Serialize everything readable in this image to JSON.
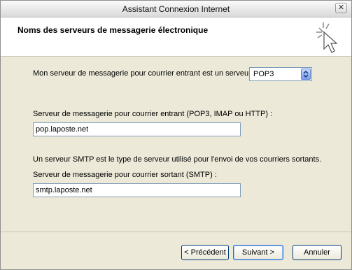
{
  "window": {
    "title": "Assistant Connexion Internet"
  },
  "icons": {
    "close": "close-icon",
    "wizard": "wizard-cursor-icon",
    "dropdown": "chevron-down-icon"
  },
  "header": {
    "title": "Noms des serveurs de messagerie électronique"
  },
  "incoming_server_type": {
    "label": "Mon serveur de messagerie pour courrier entrant est un serveur",
    "selected": "POP3"
  },
  "incoming_server": {
    "label": "Serveur de messagerie pour courrier entrant (POP3, IMAP ou HTTP) :",
    "value": "pop.laposte.net"
  },
  "smtp_info": "Un serveur SMTP est le type de serveur utilisé pour l'envoi de vos courriers sortants.",
  "outgoing_server": {
    "label": "Serveur de messagerie pour courrier sortant (SMTP) :",
    "value": "smtp.laposte.net"
  },
  "buttons": {
    "back": "< Précédent",
    "next": "Suivant >",
    "cancel": "Annuler"
  },
  "colors": {
    "panel": "#ece9d8",
    "input_border": "#7f9db9"
  }
}
